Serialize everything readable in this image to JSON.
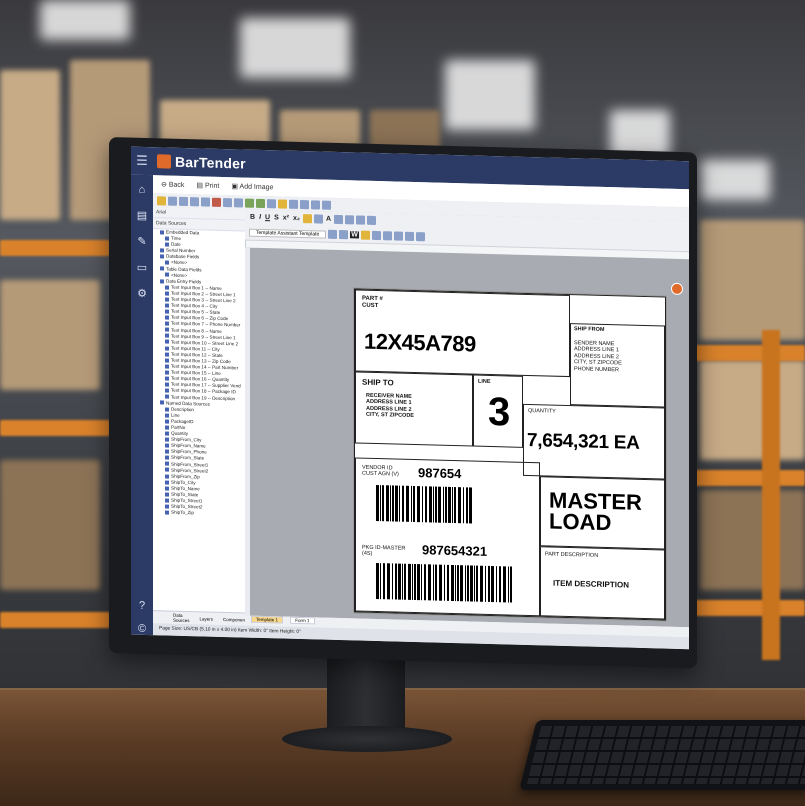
{
  "app": {
    "title": "BarTender",
    "back_label": "Back",
    "print_label": "Print",
    "add_image_label": "Add Image",
    "font_name": "Arial",
    "fmt_buttons": [
      "B",
      "I",
      "U",
      "S",
      "x²",
      "x₂",
      "A",
      "W"
    ],
    "template_selector": "Template Assistant Template",
    "status_text": "Page Size: US/CB (5.10 in x 4.00 in)  Item Width: 0\"  Item Height: 0\""
  },
  "tree": {
    "header": "Data Sources",
    "items": [
      {
        "label": "Embedded Data",
        "level": 1
      },
      {
        "label": "Time",
        "level": 2
      },
      {
        "label": "Date",
        "level": 2
      },
      {
        "label": "Serial Number",
        "level": 1
      },
      {
        "label": "Database Fields",
        "level": 1
      },
      {
        "label": "<None>",
        "level": 2
      },
      {
        "label": "Table Data Fields",
        "level": 1
      },
      {
        "label": "<None>",
        "level": 2
      },
      {
        "label": "Data Entry Fields",
        "level": 1
      },
      {
        "label": "Text Input Box 1 -- Name",
        "level": 2
      },
      {
        "label": "Text Input Box 2 -- Street Line 1",
        "level": 2
      },
      {
        "label": "Text Input Box 3 -- Street Line 2",
        "level": 2
      },
      {
        "label": "Text Input Box 4 -- City",
        "level": 2
      },
      {
        "label": "Text Input Box 5 -- State",
        "level": 2
      },
      {
        "label": "Text Input Box 6 -- Zip Code",
        "level": 2
      },
      {
        "label": "Text Input Box 7 -- Phone Number",
        "level": 2
      },
      {
        "label": "Text Input Box 8 -- Name",
        "level": 2
      },
      {
        "label": "Text Input Box 9 -- Street Line 1",
        "level": 2
      },
      {
        "label": "Text Input Box 10 -- Street Line 2",
        "level": 2
      },
      {
        "label": "Text Input Box 11 -- City",
        "level": 2
      },
      {
        "label": "Text Input Box 12 -- State",
        "level": 2
      },
      {
        "label": "Text Input Box 13 -- Zip Code",
        "level": 2
      },
      {
        "label": "Text Input Box 14 -- Part Number",
        "level": 2
      },
      {
        "label": "Text Input Box 15 -- Line",
        "level": 2
      },
      {
        "label": "Text Input Box 16 -- Quantity",
        "level": 2
      },
      {
        "label": "Text Input Box 17 -- Supplier Vend",
        "level": 2
      },
      {
        "label": "Text Input Box 18 -- Package ID",
        "level": 2
      },
      {
        "label": "Text Input Box 19 -- Description",
        "level": 2
      },
      {
        "label": "Named Data Sources",
        "level": 1
      },
      {
        "label": "Description",
        "level": 2
      },
      {
        "label": "Line",
        "level": 2
      },
      {
        "label": "PackageID",
        "level": 2
      },
      {
        "label": "PartNo",
        "level": 2
      },
      {
        "label": "Quantity",
        "level": 2
      },
      {
        "label": "ShipFrom_City",
        "level": 2
      },
      {
        "label": "ShipFrom_Name",
        "level": 2
      },
      {
        "label": "ShipFrom_Phone",
        "level": 2
      },
      {
        "label": "ShipFrom_State",
        "level": 2
      },
      {
        "label": "ShipFrom_Street1",
        "level": 2
      },
      {
        "label": "ShipFrom_Street2",
        "level": 2
      },
      {
        "label": "ShipFrom_Zip",
        "level": 2
      },
      {
        "label": "ShipTo_City",
        "level": 2
      },
      {
        "label": "ShipTo_Name",
        "level": 2
      },
      {
        "label": "ShipTo_State",
        "level": 2
      },
      {
        "label": "ShipTo_Street1",
        "level": 2
      },
      {
        "label": "ShipTo_Street2",
        "level": 2
      },
      {
        "label": "ShipTo_Zip",
        "level": 2
      }
    ],
    "tabs": [
      "Data Sources",
      "Layers",
      "Components"
    ]
  },
  "doc_tabs": [
    "Template 1",
    "Form 1"
  ],
  "label": {
    "part_caption": "PART #\nCUST",
    "part_number": "12X45A789",
    "ship_from_caption": "SHIP FROM",
    "ship_from_lines": "SENDER NAME\nADDRESS LINE 1\nADDRESS LINE 2\nCITY, ST ZIPCODE\nPHONE NUMBER",
    "ship_to_caption": "SHIP TO",
    "ship_to_lines": "RECEIVER NAME\nADDRESS LINE 1\nADDRESS LINE 2\nCITY, ST ZIPCODE",
    "line_caption": "LINE",
    "line_value": "3",
    "qty_caption": "QUANTITY",
    "qty_value": "7,654,321 EA",
    "vendor_caption": "VENDOR ID\nCUST AGN (V)",
    "vendor_value": "987654",
    "master_load": "MASTER\nLOAD",
    "pkg_caption": "PKG ID-MASTER\n(4S)",
    "pkg_value": "987654321",
    "part_desc_caption": "PART DESCRIPTION",
    "item_description": "ITEM DESCRIPTION"
  },
  "icons": [
    "menu-icon",
    "home-icon",
    "print-icon",
    "design-icon",
    "folder-icon",
    "settings-icon",
    "help-icon",
    "copyright-icon"
  ],
  "colors": {
    "titlebar": "#2c3a66",
    "accent": "#e06a2a"
  }
}
